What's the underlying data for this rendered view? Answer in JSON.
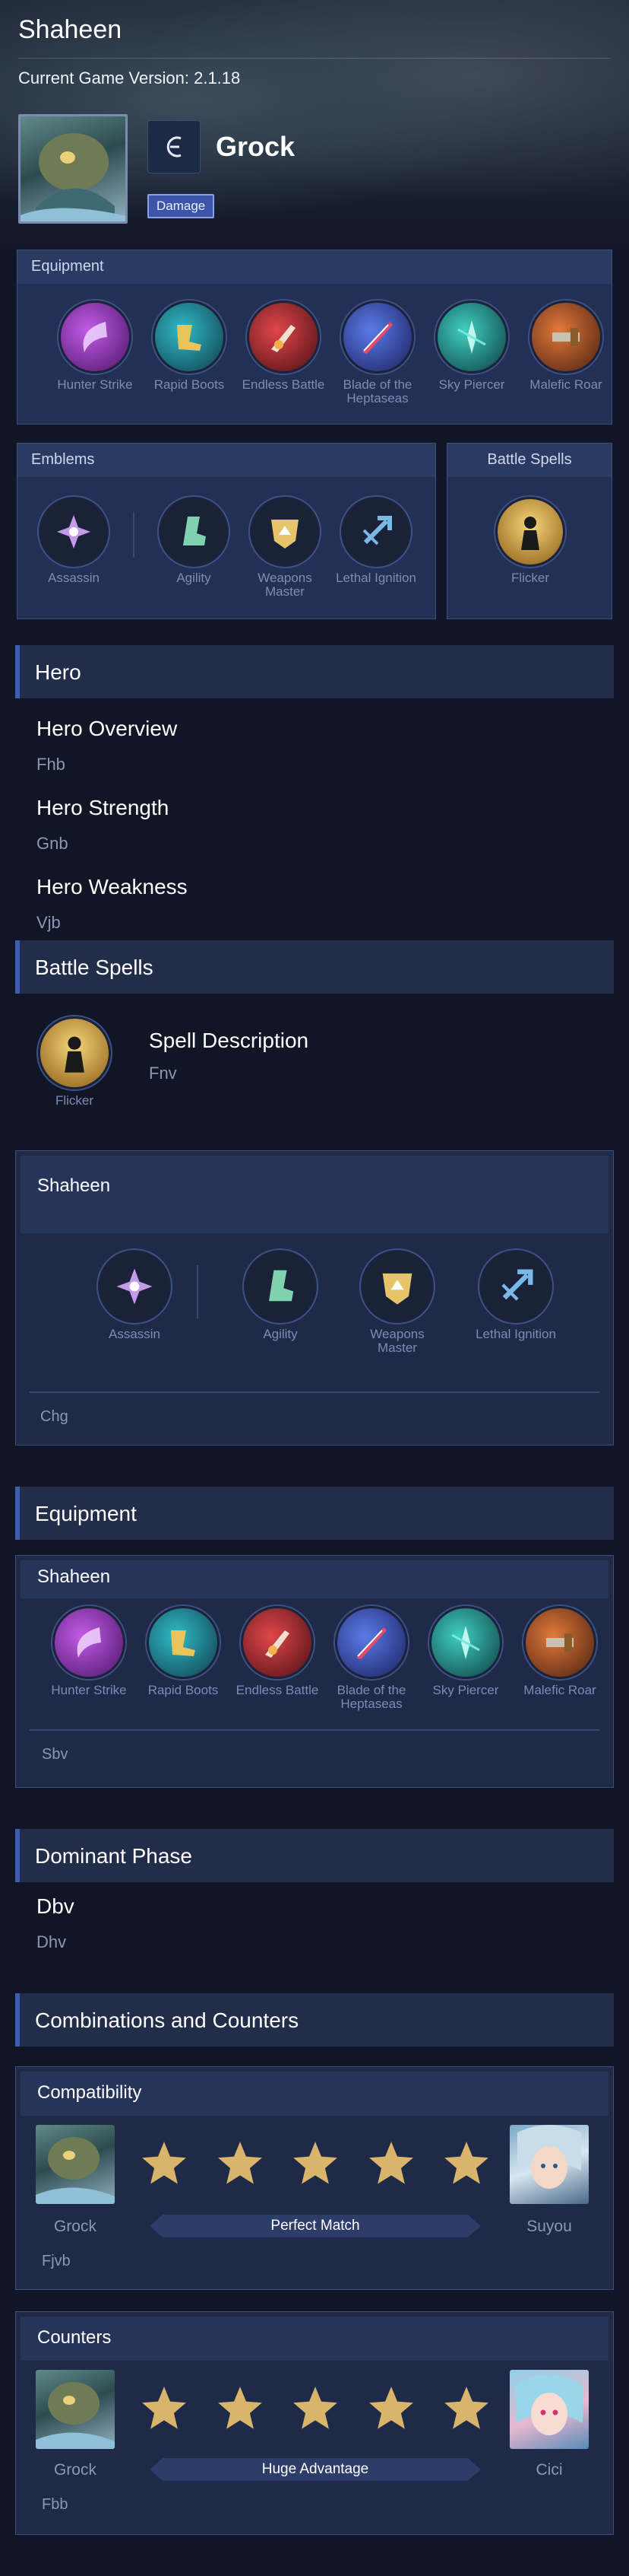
{
  "header": {
    "title": "Shaheen",
    "version": "Current Game Version: 2.1.18",
    "hero_name": "Grock",
    "role_badge": "Damage"
  },
  "equipment_top": {
    "title": "Equipment",
    "items": [
      {
        "label": "Hunter Strike",
        "icon": "hunter-strike-icon",
        "color": "#8a2fb8"
      },
      {
        "label": "Rapid Boots",
        "icon": "rapid-boots-icon",
        "color": "#2b8aa0"
      },
      {
        "label": "Endless Battle",
        "icon": "endless-battle-icon",
        "color": "#b8322e"
      },
      {
        "label": "Blade of the Heptaseas",
        "icon": "blade-heptaseas-icon",
        "color": "#3252c8"
      },
      {
        "label": "Sky Piercer",
        "icon": "sky-piercer-icon",
        "color": "#1f8a8a"
      },
      {
        "label": "Malefic Roar",
        "icon": "malefic-roar-icon",
        "color": "#c25a2a"
      }
    ]
  },
  "emblems_top": {
    "title": "Emblems",
    "items": [
      {
        "label": "Assassin",
        "icon": "assassin-emblem-icon",
        "color": "#c59ae8"
      },
      {
        "label": "Agility",
        "icon": "agility-emblem-icon",
        "color": "#7fd1b0"
      },
      {
        "label": "Weapons Master",
        "icon": "weapons-master-emblem-icon",
        "color": "#e6c46a"
      },
      {
        "label": "Lethal Ignition",
        "icon": "lethal-ignition-emblem-icon",
        "color": "#7ab8e8"
      }
    ]
  },
  "battle_spells_top": {
    "title": "Battle Spells",
    "spell": "Flicker"
  },
  "hero_section": {
    "title": "Hero",
    "overview_title": "Hero Overview",
    "overview_value": "Fhb",
    "strength_title": "Hero Strength",
    "strength_value": "Gnb",
    "weakness_title": "Hero Weakness",
    "weakness_value": "Vjb"
  },
  "battle_spells_section": {
    "title": "Battle Spells",
    "spell": "Flicker",
    "desc_title": "Spell Description",
    "desc_value": "Fnv"
  },
  "emblem_panel": {
    "title": "Shaheen",
    "items": [
      {
        "label": "Assassin"
      },
      {
        "label": "Agility"
      },
      {
        "label": "Weapons Master"
      },
      {
        "label": "Lethal Ignition"
      }
    ],
    "note": "Chg"
  },
  "equipment_section": {
    "title": "Equipment",
    "panel_title": "Shaheen",
    "items": [
      {
        "label": "Hunter Strike"
      },
      {
        "label": "Rapid Boots"
      },
      {
        "label": "Endless Battle"
      },
      {
        "label": "Blade of the Heptaseas"
      },
      {
        "label": "Sky Piercer"
      },
      {
        "label": "Malefic Roar"
      }
    ],
    "note": "Sbv"
  },
  "dominant_phase": {
    "title": "Dominant Phase",
    "phase": "Dbv",
    "detail": "Dhv"
  },
  "combos": {
    "title": "Combinations and Counters",
    "compatibility": {
      "title": "Compatibility",
      "left": "Grock",
      "right": "Suyou",
      "rating": 5,
      "ribbon": "Perfect Match",
      "note": "Fjvb"
    },
    "counters": {
      "title": "Counters",
      "left": "Grock",
      "right": "Cici",
      "rating": 5,
      "ribbon": "Huge Advantage",
      "note": "Fbb"
    }
  },
  "colors": {
    "accent": "#3e5db1",
    "panel": "#233055",
    "star": "#d8b56a"
  }
}
